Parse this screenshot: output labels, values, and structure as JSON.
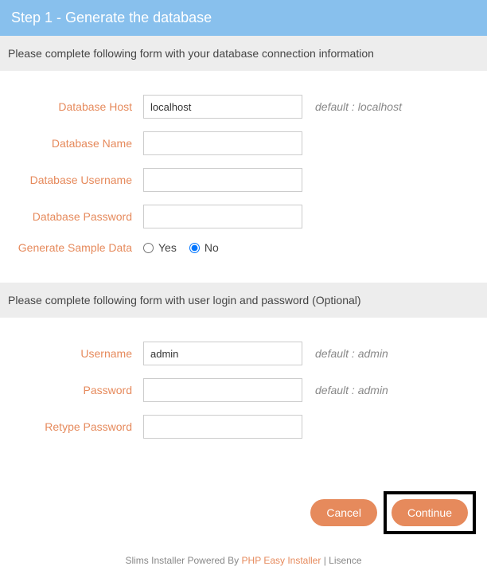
{
  "header": {
    "title": "Step 1 - Generate the database"
  },
  "section1": {
    "desc": "Please complete following form with your database connection information",
    "fields": {
      "host": {
        "label": "Database Host",
        "value": "localhost",
        "hint": "default : localhost"
      },
      "name": {
        "label": "Database Name",
        "value": ""
      },
      "user": {
        "label": "Database Username",
        "value": ""
      },
      "pass": {
        "label": "Database Password",
        "value": ""
      },
      "sample": {
        "label": "Generate Sample Data",
        "yes": "Yes",
        "no": "No"
      }
    }
  },
  "section2": {
    "desc": "Please complete following form with user login and password (Optional)",
    "fields": {
      "username": {
        "label": "Username",
        "value": "admin",
        "hint": "default : admin"
      },
      "password": {
        "label": "Password",
        "value": "",
        "hint": "default : admin"
      },
      "retype": {
        "label": "Retype Password",
        "value": ""
      }
    }
  },
  "buttons": {
    "cancel": "Cancel",
    "continue": "Continue"
  },
  "footer": {
    "prefix": "Slims Installer Powered By ",
    "link": "PHP Easy Installer",
    "sep": " | ",
    "lisence": "Lisence"
  }
}
